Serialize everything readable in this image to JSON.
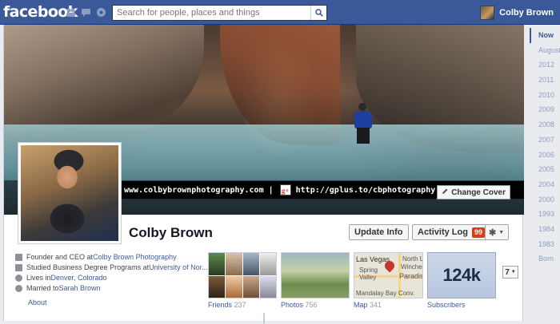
{
  "topbar": {
    "logo": "facebook",
    "search_placeholder": "Search for people, places and things",
    "user_name": "Colby Brown",
    "icons": [
      "friend-requests-icon",
      "messages-icon",
      "notifications-icon",
      "search-icon"
    ]
  },
  "cover": {
    "links": [
      "www.colbybrownphotography.com",
      "|",
      "http://gplus.to/cbphotography",
      "|",
      "@"
    ],
    "gplus_glyph": "g+",
    "twitter_icon": "twitter-bird-icon",
    "change_cover_label": "Change Cover"
  },
  "profile": {
    "name": "Colby Brown",
    "update_info_label": "Update Info",
    "activity_log_label": "Activity Log",
    "activity_log_count": "99",
    "gear_menu": "gear-icon"
  },
  "about": {
    "items": [
      {
        "icon": "work-icon",
        "text": "Founder and CEO at ",
        "link": "Colby Brown Photography"
      },
      {
        "icon": "education-icon",
        "text": "Studied Business Degree Programs at ",
        "link": "University of Nor..."
      },
      {
        "icon": "home-icon",
        "text": "Lives in ",
        "link": "Denver, Colorado"
      },
      {
        "icon": "heart-icon",
        "text": "Married to ",
        "link": "Sarah Brown"
      }
    ],
    "label": "About"
  },
  "tiles": {
    "friends": {
      "label": "Friends",
      "count": "237"
    },
    "photos": {
      "label": "Photos",
      "count": "756"
    },
    "map": {
      "label": "Map",
      "count": "341",
      "places": [
        "Las Vegas",
        "North L",
        "Winchester",
        "Spring",
        "Valley",
        "Paradise",
        "Mandalay Bay Conv."
      ]
    },
    "subscribers": {
      "label": "Subscribers",
      "value": "124k"
    },
    "more_count": "7"
  },
  "scrubber": {
    "years": [
      "Now",
      "August",
      "2012",
      "2011",
      "2010",
      "2009",
      "2008",
      "2007",
      "2006",
      "2005",
      "2004",
      "2000",
      "1993",
      "1984",
      "1983",
      "Born"
    ],
    "active": "Now"
  },
  "colors": {
    "brand": "#3b5998",
    "badge": "#dd3c10"
  }
}
